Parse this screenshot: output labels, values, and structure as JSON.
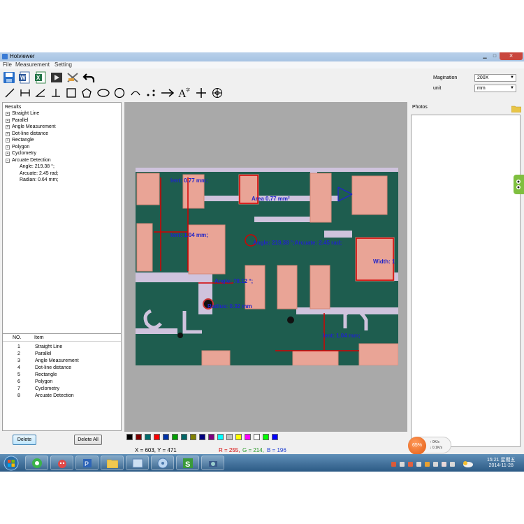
{
  "window": {
    "title": "Hotviewer",
    "min": "▁",
    "max": "□",
    "close": "✕"
  },
  "menu": {
    "file": "File",
    "measurement": "Measurement",
    "setting": "Setting"
  },
  "toolbar_icons": [
    "save-icon",
    "word-export-icon",
    "excel-export-icon",
    "play-icon",
    "clear-icon",
    "undo-icon",
    "line-tool-icon",
    "parallel-tool-icon",
    "angle-tool-icon",
    "perpendicular-tool-icon",
    "rectangle-tool-icon",
    "polygon-tool-icon",
    "ellipse-tool-icon",
    "circle-tool-icon",
    "arc-tool-icon",
    "dot-line-tool-icon",
    "arrow-tool-icon",
    "text-tool-icon",
    "crosshair-tool-icon",
    "target-tool-icon"
  ],
  "settings": {
    "magnification_label": "Magination",
    "magnification_value": "200X",
    "unit_label": "unit",
    "unit_value": "mm"
  },
  "results": {
    "root": "Results",
    "items": [
      "Straight Line",
      "Parallel",
      "Angle Measurement",
      "Dot-line distance",
      "Rectangle",
      "Polygon",
      "Cyclometry",
      "Arcuate Detection"
    ],
    "details": [
      "Angle: 219.38 °;",
      "Arcuate: 2.45 rad;",
      "Radian: 0.64 mm;"
    ]
  },
  "table": {
    "col_no": "NO.",
    "col_item": "Item",
    "rows": [
      {
        "no": "1",
        "item": "Straight Line"
      },
      {
        "no": "2",
        "item": "Parallel"
      },
      {
        "no": "3",
        "item": "Angle Measurement"
      },
      {
        "no": "4",
        "item": "Dot-line distance"
      },
      {
        "no": "5",
        "item": "Rectangle"
      },
      {
        "no": "6",
        "item": "Polygon"
      },
      {
        "no": "7",
        "item": "Cyclometry"
      },
      {
        "no": "8",
        "item": "Arcuate Detection"
      }
    ]
  },
  "buttons": {
    "delete": "Delete",
    "delete_all": "Delete All"
  },
  "measurements": {
    "lent_top": "lent: 0.77 mm;",
    "area": "Area 0.77 mm²",
    "lent_mid": "lent: 1.04 mm;",
    "angle_arc": "Angle: 219.38 °;Arcuate: 2.45 rad;",
    "width": "Width: 1",
    "angle": "Angle: 78.12 °;",
    "radius": "Radius: 0.32 mm",
    "lent_bottom": "lent: 1.04 mm;"
  },
  "palette": [
    "#000000",
    "#7f0000",
    "#006b6b",
    "#ff0000",
    "#0033aa",
    "#00a000",
    "#006666",
    "#808000",
    "#000080",
    "#800080",
    "#00ffff",
    "#c0c0c0",
    "#ffff00",
    "#ff00ff",
    "#ffffff",
    "#00ff00",
    "#0000ff"
  ],
  "status": {
    "coords": "X = 603, Y = 471",
    "r": "R = 255,",
    "g": "G = 214,",
    "b": "B = 196",
    "r_color": "#d40000",
    "g_color": "#2a9a2a",
    "b_color": "#2040d0"
  },
  "photos": {
    "title": "Photos"
  },
  "network": {
    "percent": "65%",
    "up": "0K/s",
    "down": "0.1K/s"
  },
  "clock": {
    "time": "15:21 星期五",
    "date": "2014-11-28"
  }
}
